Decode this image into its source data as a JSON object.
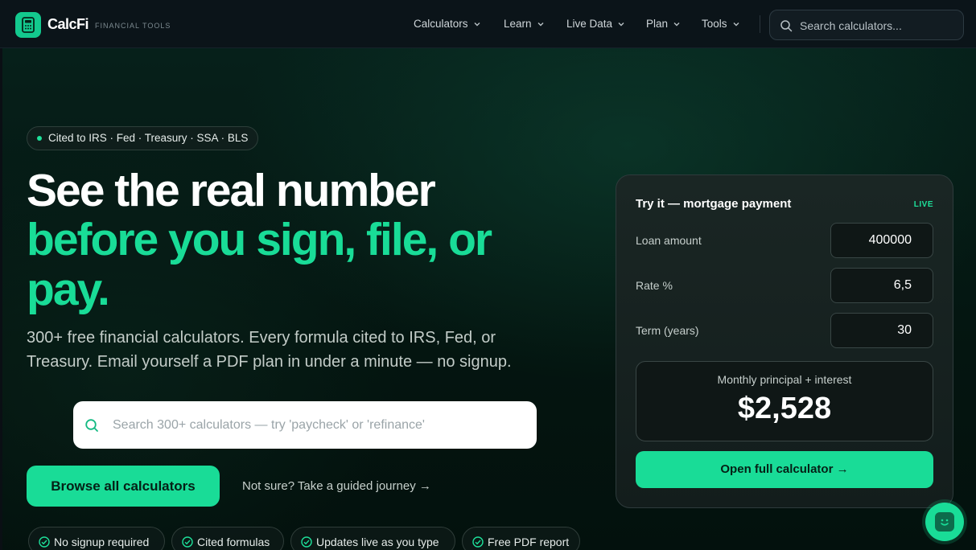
{
  "brand": {
    "name": "CalcFi",
    "tagline": "FINANCIAL TOOLS",
    "logo_icon": "calculator-icon",
    "accent": "#19dc97"
  },
  "nav": {
    "items": [
      {
        "label": "Calculators"
      },
      {
        "label": "Learn"
      },
      {
        "label": "Live Data"
      },
      {
        "label": "Plan"
      },
      {
        "label": "Tools"
      }
    ],
    "search_placeholder": "Search calculators..."
  },
  "hero": {
    "pill": "Cited to IRS · Fed · Treasury · SSA · BLS",
    "headline_line1": "See the real number",
    "headline_line2": "before you sign, file, or",
    "headline_line3": "pay.",
    "subtitle_line1": "300+ free financial calculators. Every formula cited to IRS, Fed, or",
    "subtitle_line2": "Treasury. Email yourself a PDF plan in under a minute — no signup.",
    "search_placeholder": "Search 300+ calculators — try 'paycheck' or 'refinance'",
    "primary_button": "Browse all calculators",
    "secondary_link": "Not sure? Take a guided journey →",
    "chips": [
      {
        "label": "No signup required"
      },
      {
        "label": "Cited formulas"
      },
      {
        "label": "Updates live as you type"
      },
      {
        "label": "Free PDF report"
      }
    ]
  },
  "widget": {
    "title": "Try it — mortgage payment",
    "badge": "LIVE",
    "fields": [
      {
        "label": "Loan amount",
        "value": "400000"
      },
      {
        "label": "Rate %",
        "value": "6,5"
      },
      {
        "label": "Term (years)",
        "value": "30"
      }
    ],
    "result_label": "Monthly principal + interest",
    "result_value": "$2,528",
    "button": "Open full calculator →"
  },
  "chat_button": {
    "icon": "chat-smile-icon"
  }
}
